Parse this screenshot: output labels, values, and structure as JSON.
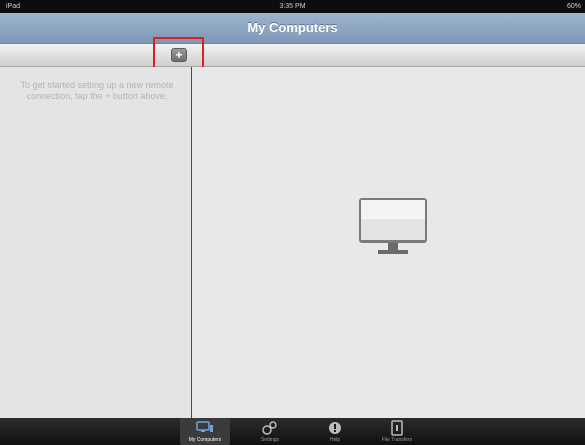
{
  "status_bar": {
    "carrier": "iPad",
    "time": "3:35 PM",
    "battery": "60%"
  },
  "title_bar": {
    "title": "My Computers"
  },
  "toolbar": {
    "add_button": "+"
  },
  "left_pane": {
    "hint": "To get started setting up a new remote connection, tap the + button above."
  },
  "tabs": [
    {
      "label": "My Computers",
      "icon": "my-computers-icon",
      "selected": true
    },
    {
      "label": "Settings",
      "icon": "settings-icon",
      "selected": false
    },
    {
      "label": "Help",
      "icon": "help-icon",
      "selected": false
    },
    {
      "label": "File Transfers",
      "icon": "file-transfers-icon",
      "selected": false
    }
  ],
  "colors": {
    "title_bar": "#8aa3c0",
    "tab_bar": "#1a1a1a",
    "highlight": "#e02020"
  }
}
